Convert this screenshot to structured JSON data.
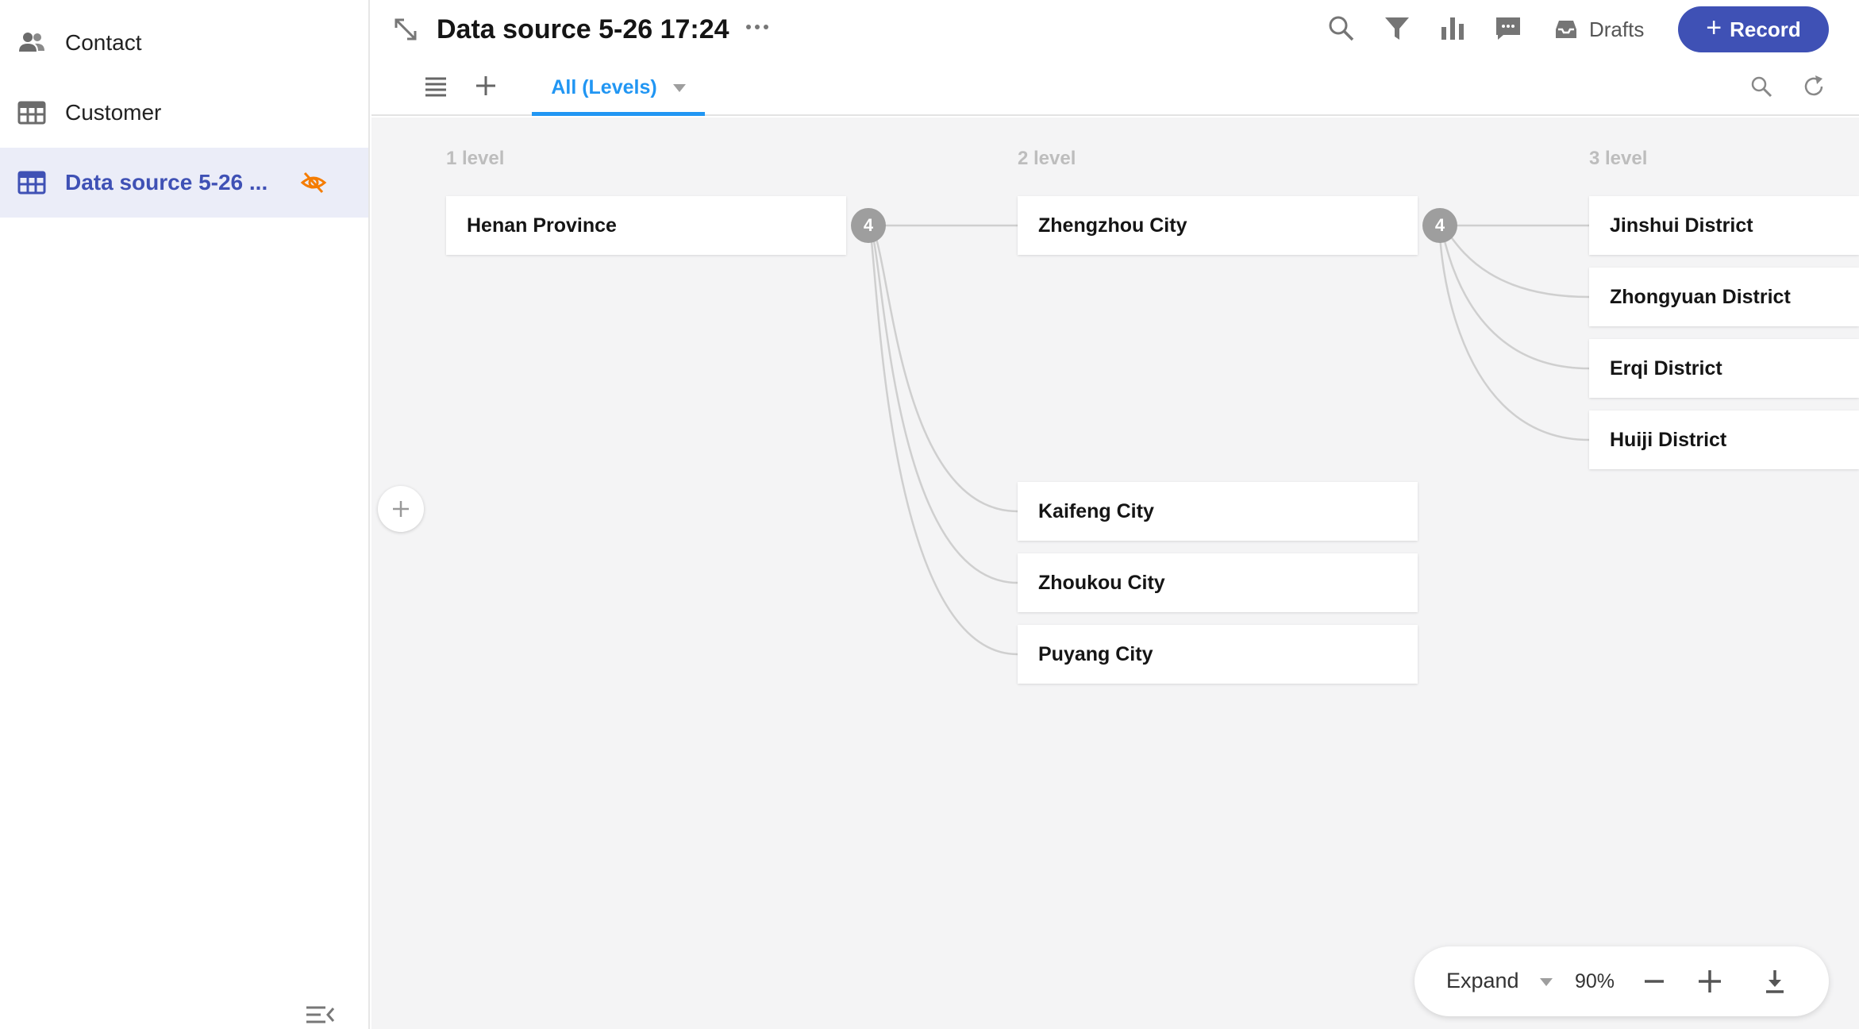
{
  "sidebar": {
    "items": [
      {
        "label": "Contact",
        "icon": "contacts-icon",
        "active": false
      },
      {
        "label": "Customer",
        "icon": "table-icon",
        "active": false
      },
      {
        "label": "Data source 5-26 ...",
        "icon": "table-icon",
        "active": true
      }
    ]
  },
  "header": {
    "title": "Data source 5-26 17:24",
    "drafts_label": "Drafts",
    "record_label": "Record",
    "tab_label": "All (Levels)"
  },
  "hierarchy": {
    "levels": [
      "1 level",
      "2 level",
      "3 level"
    ],
    "level1": [
      {
        "label": "Henan Province",
        "children_count": "4"
      }
    ],
    "level2": [
      {
        "label": "Zhengzhou City",
        "children_count": "4"
      },
      {
        "label": "Kaifeng City"
      },
      {
        "label": "Zhoukou City"
      },
      {
        "label": "Puyang City"
      }
    ],
    "level3": [
      {
        "label": "Jinshui District"
      },
      {
        "label": "Zhongyuan District"
      },
      {
        "label": "Erqi District"
      },
      {
        "label": "Huiji District"
      }
    ]
  },
  "toolbar": {
    "expand_label": "Expand",
    "zoom": "90%"
  },
  "colors": {
    "accent": "#3f51b5",
    "tab_blue": "#2196f3",
    "hidden_icon": "#f57c00",
    "link": "#cfcfcf",
    "badge": "#9e9e9e"
  }
}
